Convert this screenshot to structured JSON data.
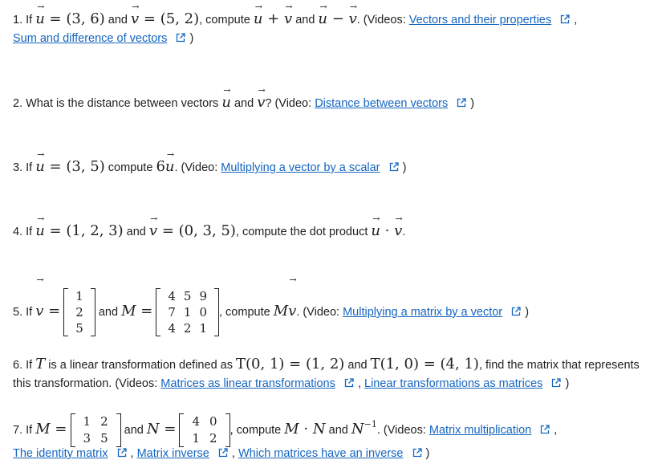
{
  "p1": {
    "num": "1.",
    "if": "If",
    "u": "u",
    "eq1": "= (3, 6)",
    "and1": "and",
    "v": "v",
    "eq2": "= (5, 2)",
    "compute": ", compute",
    "sum": "+",
    "and2": "and",
    "minus": "−",
    "end": ". (Videos:",
    "link1": "Vectors and their properties",
    "comma": ",",
    "link2": "Sum and difference of vectors",
    "close": ")"
  },
  "p2": {
    "num": "2.",
    "text1": "What is the distance between vectors",
    "u": "u",
    "and": "and",
    "v": "v",
    "text2": "? (Video:",
    "link": "Distance between vectors",
    "close": ")"
  },
  "p3": {
    "num": "3.",
    "if": "If",
    "u": "u",
    "eq": "= (3, 5)",
    "compute": "compute",
    "six": "6",
    "end": ". (Video:",
    "link": "Multiplying a vector by a scalar",
    "close": ")"
  },
  "p4": {
    "num": "4.",
    "if": "If",
    "u": "u",
    "eq1": "= (1, 2, 3)",
    "and": "and",
    "v": "v",
    "eq2": "= (0, 3, 5)",
    "text": ", compute the dot product",
    "dot": "·",
    "period": "."
  },
  "p5": {
    "num": "5.",
    "if": "If",
    "v": "v",
    "eq": "=",
    "v_vals": [
      "1",
      "2",
      "5"
    ],
    "and": "and",
    "M": "M",
    "eq2": "=",
    "M_rows": [
      [
        "4",
        "5",
        "9"
      ],
      [
        "7",
        "1",
        "0"
      ],
      [
        "4",
        "2",
        "1"
      ]
    ],
    "compute": ", compute",
    "Mv_M": "M",
    "Mv_v": "v",
    "end": ". (Video:",
    "link": "Multiplying a matrix by a vector",
    "close": ")"
  },
  "p6": {
    "num": "6.",
    "if": "If",
    "T": "T",
    "text1": "is a linear transformation defined as",
    "def1": "T(0, 1) = (1, 2)",
    "and": "and",
    "def2": "T(1, 0) = (4, 1)",
    "text2": ", find the matrix that represents",
    "line2": "this transformation. (Videos:",
    "link1": "Matrices as linear transformations",
    "comma": ",",
    "link2": "Linear transformations as matrices",
    "close": ")"
  },
  "p7": {
    "num": "7.",
    "if": "If",
    "M": "M",
    "eq": "=",
    "M_rows": [
      [
        "1",
        "2"
      ],
      [
        "3",
        "5"
      ]
    ],
    "and": "and",
    "N": "N",
    "eq2": "=",
    "N_rows": [
      [
        "4",
        "0"
      ],
      [
        "1",
        "2"
      ]
    ],
    "compute": ", compute",
    "prod": "M · N",
    "and2": "and",
    "Ninv": "N",
    "inv": "−1",
    "end": ". (Videos:",
    "link1": "Matrix multiplication",
    "comma1": ",",
    "link2": "The identity matrix",
    "comma2": ",",
    "link3": "Matrix inverse",
    "comma3": ",",
    "link4": "Which matrices have an inverse",
    "close": ")"
  },
  "colors": {
    "link": "#1565c0",
    "text": "#1f1f1f"
  },
  "icons": {
    "external": "external-link-icon"
  }
}
